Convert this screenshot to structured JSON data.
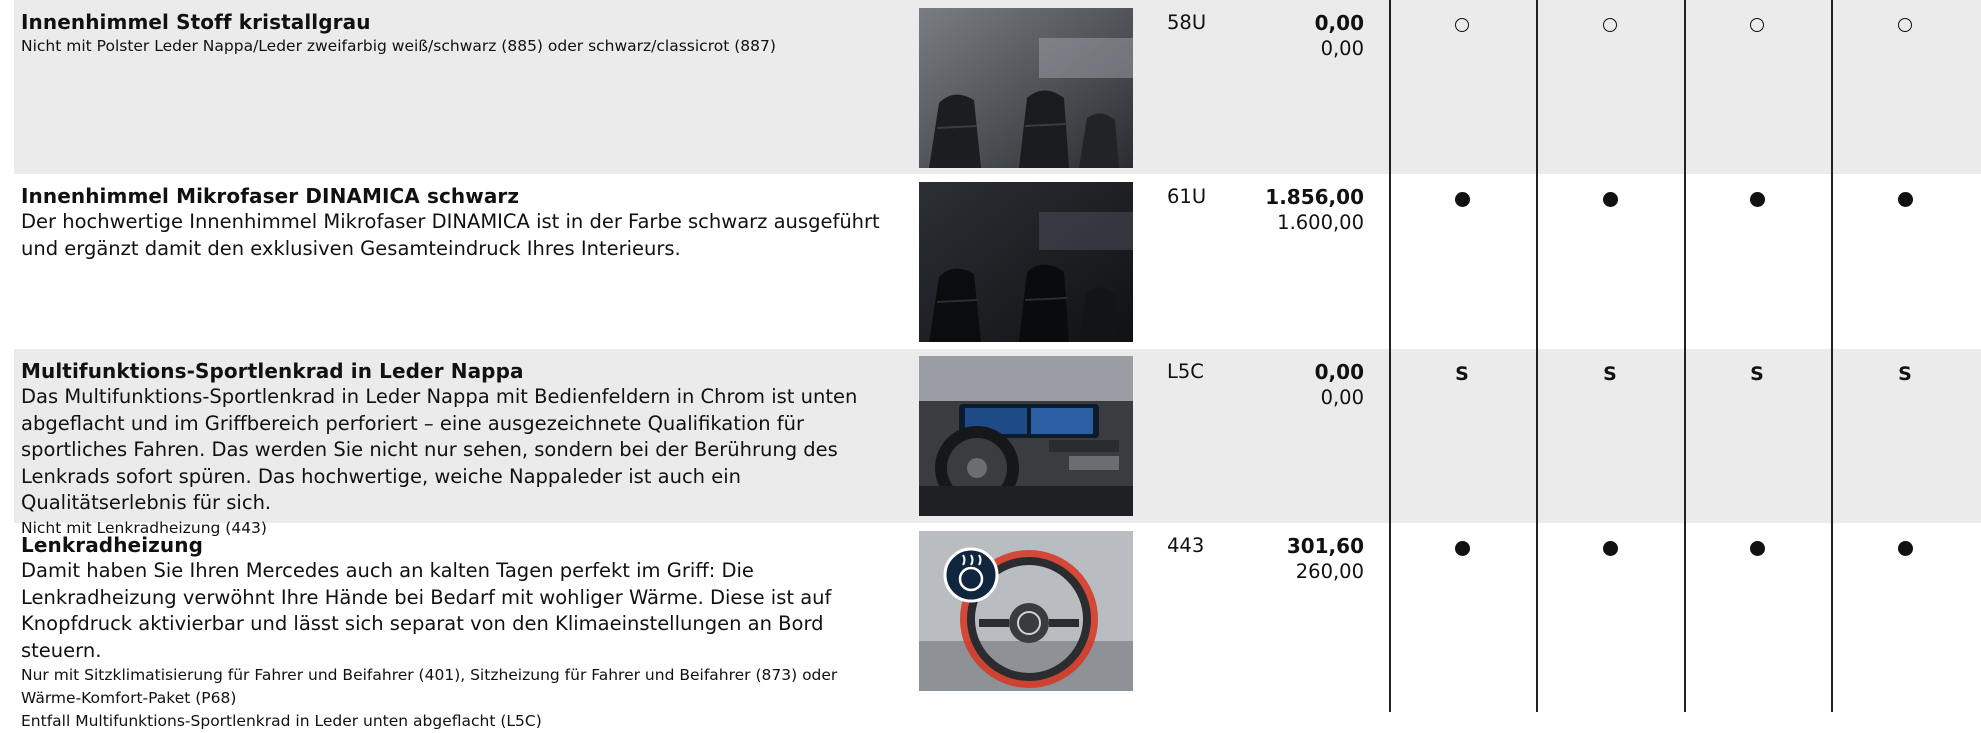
{
  "columns": [
    "col1",
    "col2",
    "col3",
    "col4"
  ],
  "rows": [
    {
      "title": "Innenhimmel Stoff kristallgrau",
      "body": "",
      "notes": [
        "Nicht mit Polster Leder Nappa/Leder zweifarbig weiß/schwarz (885) oder schwarz/classicrot (887)"
      ],
      "image": "interior-headliner-grey-photo",
      "code": "58U",
      "price_gross": "0,00",
      "price_net": "0,00",
      "availability": [
        "optional-icon",
        "optional-icon",
        "optional-icon",
        "optional-icon"
      ]
    },
    {
      "title": "Innenhimmel Mikrofaser DINAMICA schwarz",
      "body": "Der hochwertige Innenhimmel Mikrofaser DINAMICA ist in der Farbe schwarz ausgeführt und ergänzt damit den exklusiven Gesamteindruck Ihres Interieurs.",
      "notes": [],
      "image": "interior-headliner-black-photo",
      "code": "61U",
      "price_gross": "1.856,00",
      "price_net": "1.600,00",
      "availability": [
        "available-icon",
        "available-icon",
        "available-icon",
        "available-icon"
      ]
    },
    {
      "title": "Multifunktions-Sportlenkrad in Leder Nappa",
      "body": "Das Multifunktions-Sportlenkrad in Leder Nappa mit Bedienfeldern in Chrom ist unten abgeflacht und im Griffbereich perforiert – eine ausgezeichnete Qualifikation für sportliches Fahren. Das werden Sie nicht nur sehen, sondern bei der Berührung des Lenkrads sofort spüren. Das hochwertige, weiche Nappaleder ist auch ein Qualitätserlebnis für sich.",
      "notes": [
        "Nicht mit Lenkradheizung (443)"
      ],
      "image": "cockpit-steering-wheel-photo",
      "code": "L5C",
      "price_gross": "0,00",
      "price_net": "0,00",
      "availability": [
        "S",
        "S",
        "S",
        "S"
      ]
    },
    {
      "title": "Lenkradheizung",
      "body": "Damit haben Sie Ihren Mercedes auch an kalten Tagen perfekt im Griff: Die Lenkradheizung verwöhnt Ihre Hände bei Bedarf mit wohliger Wärme. Diese ist auf Knopfdruck aktivierbar und lässt sich separat von den Klimaeinstellungen an Bord steuern.",
      "notes": [
        "Nur mit Sitzklimatisierung für Fahrer und Beifahrer (401), Sitzheizung für Fahrer und Beifahrer (873) oder Wärme-Komfort-Paket (P68)",
        "Entfall Multifunktions-Sportlenkrad in Leder unten abgeflacht (L5C)"
      ],
      "image": "heated-steering-wheel-photo",
      "code": "443",
      "price_gross": "301,60",
      "price_net": "260,00",
      "availability": [
        "available-icon",
        "available-icon",
        "available-icon",
        "available-icon"
      ]
    }
  ]
}
